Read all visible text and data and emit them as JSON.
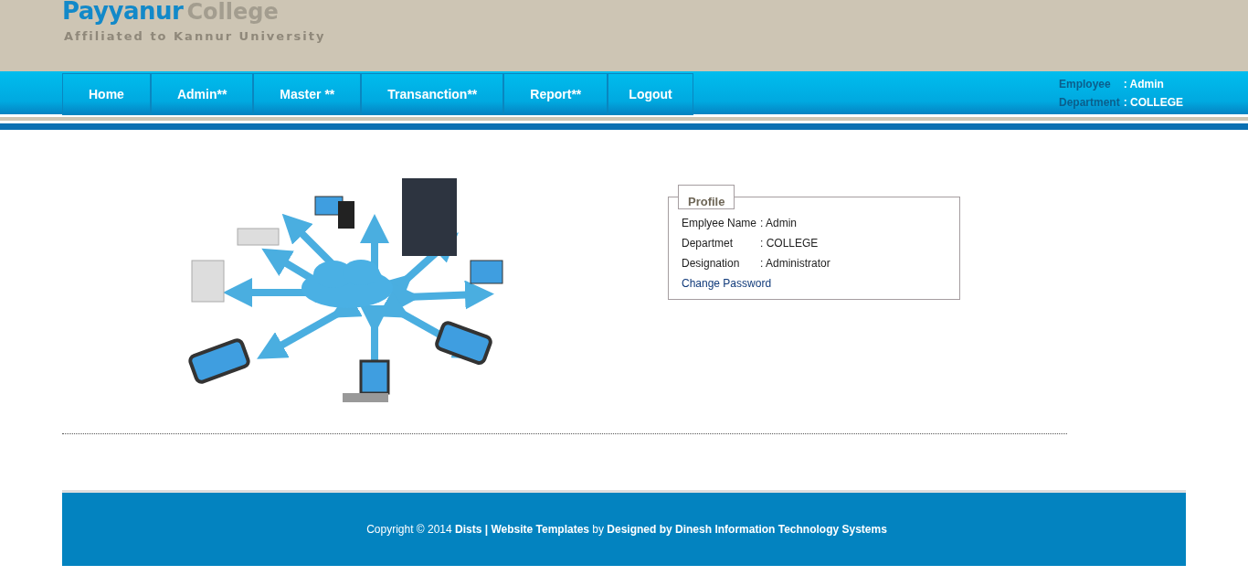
{
  "header": {
    "brand_primary": "Payyanur",
    "brand_secondary": "College",
    "tagline": "Affiliated to Kannur University"
  },
  "nav": {
    "items": [
      {
        "label": "Home"
      },
      {
        "label": "Admin**"
      },
      {
        "label": "Master **"
      },
      {
        "label": "Transanction**"
      },
      {
        "label": "Report**"
      },
      {
        "label": "Logout"
      }
    ],
    "user_info": [
      {
        "label": "Employee",
        "value": ": Admin"
      },
      {
        "label": "Department",
        "value": ": COLLEGE"
      }
    ]
  },
  "profile": {
    "title": "Profile",
    "fields": [
      {
        "label": "Emplyee Name",
        "value": ": Admin"
      },
      {
        "label": "Departmet",
        "value": ": COLLEGE"
      },
      {
        "label": "Designation",
        "value": ": Administrator"
      }
    ],
    "link": "Change Password"
  },
  "footer": {
    "text": "Copyright © 2014 **Dists | Website Templates** by **Designed by Dinesh Information Technology Systems**"
  }
}
